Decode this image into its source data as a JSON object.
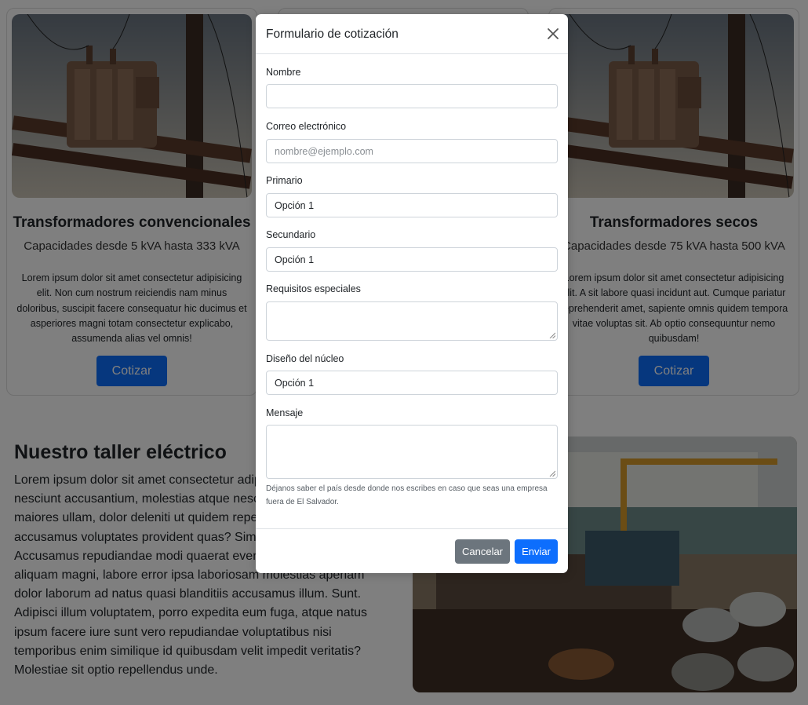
{
  "cards": [
    {
      "title": "Transformadores convencionales",
      "subtitle": "Capacidades desde 5 kVA hasta 333 kVA",
      "text": "Lorem ipsum dolor sit amet consectetur adipisicing elit. Non cum nostrum reiciendis nam minus doloribus, suscipit facere consequatur hic ducimus et asperiores magni totam consectetur explicabo, assumenda alias vel omnis!",
      "button": "Cotizar"
    },
    {
      "title": "",
      "subtitle": "",
      "text": "",
      "button": ""
    },
    {
      "title": "Transformadores secos",
      "subtitle": "Capacidades desde 75 kVA hasta 500 kVA",
      "text": "Lorem ipsum dolor sit amet consectetur adipisicing elit. A sit labore quasi incidunt aut. Cumque pariatur reprehenderit amet, sapiente omnis quidem tempora vitae voluptas sit. Ab optio consequuntur nemo quibusdam!",
      "button": "Cotizar"
    }
  ],
  "section": {
    "title": "Nuestro taller eléctrico",
    "text": "Lorem ipsum dolor sit amet consectetur adipisicing elit. Quo nesciunt accusantium, molestias atque nesciunt et praesentium maiores ullam, dolor deleniti ut quidem repellendus illum sed ipsa, accusamus voluptates provident quas? Similique perferendis iste. Accusamus repudiandae modi quaerat eveniet obcaecati, cumque aliquam magni, labore error ipsa laboriosam molestias aperiam dolor laborum ad natus quasi blanditiis accusamus illum. Sunt. Adipisci illum voluptatem, porro expedita eum fuga, atque natus ipsum facere iure sunt vero repudiandae voluptatibus nisi temporibus enim similique id quibusdam velit impedit veritatis? Molestiae sit optio repellendus unde."
  },
  "modal": {
    "title": "Formulario de cotización",
    "fields": {
      "nombre": {
        "label": "Nombre",
        "value": ""
      },
      "correo": {
        "label": "Correo electrónico",
        "placeholder": "nombre@ejemplo.com"
      },
      "primario": {
        "label": "Primario",
        "value": "Opción 1"
      },
      "secundario": {
        "label": "Secundario",
        "value": "Opción 1"
      },
      "requisitos": {
        "label": "Requisitos especiales",
        "value": ""
      },
      "diseno": {
        "label": "Diseño del núcleo",
        "value": "Opción 1"
      },
      "mensaje": {
        "label": "Mensaje",
        "value": ""
      }
    },
    "help": "Déjanos saber el país desde donde nos escribes en caso que seas una empresa fuera de El Salvador.",
    "cancel": "Cancelar",
    "send": "Enviar"
  },
  "colors": {
    "primary": "#0d6efd",
    "secondary": "#6c757d",
    "backdrop": "rgba(0,0,0,0.5)"
  },
  "icons": [
    "close-icon",
    "resize-handle-icon"
  ]
}
